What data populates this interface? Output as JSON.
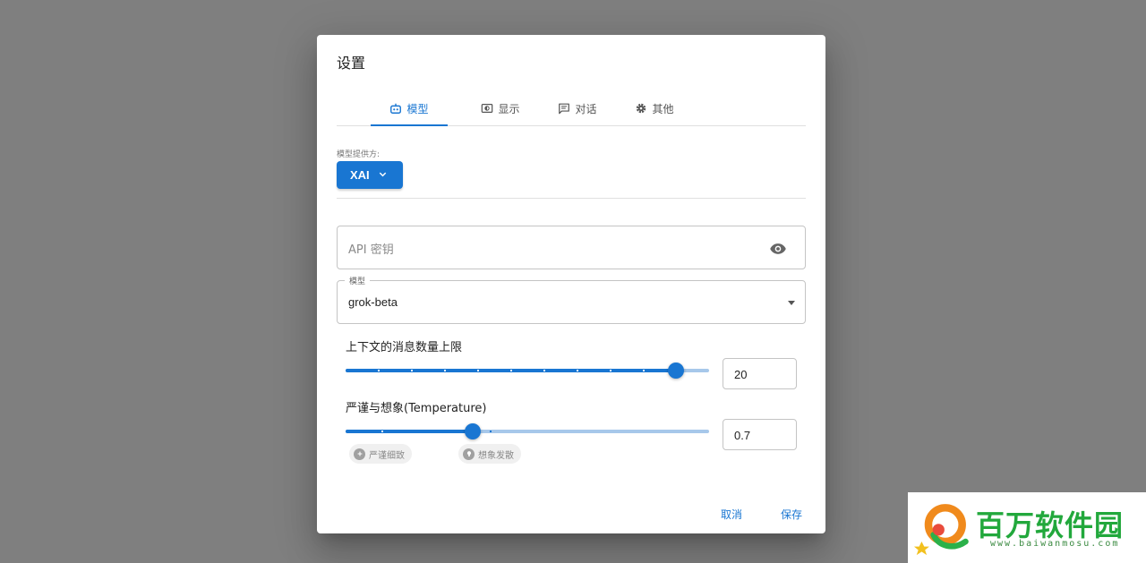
{
  "dialog": {
    "title": "设置"
  },
  "tabs": [
    {
      "label": "模型",
      "icon": "robot-icon",
      "active": true
    },
    {
      "label": "显示",
      "icon": "display-icon",
      "active": false
    },
    {
      "label": "对话",
      "icon": "chat-icon",
      "active": false
    },
    {
      "label": "其他",
      "icon": "gear-icon",
      "active": false
    }
  ],
  "provider": {
    "label": "模型提供方:",
    "value": "XAI"
  },
  "api_key": {
    "placeholder": "API 密钥",
    "value": ""
  },
  "model": {
    "legend": "模型",
    "value": "grok-beta"
  },
  "context_limit": {
    "label": "上下文的消息数量上限",
    "value": "20",
    "fraction": 0.91
  },
  "temperature": {
    "label": "严谨与想象(Temperature)",
    "value": "0.7",
    "fraction": 0.35,
    "chips": [
      "严谨细致",
      "想象发散"
    ]
  },
  "actions": {
    "cancel": "取消",
    "save": "保存"
  },
  "watermark": {
    "text": "百万软件园",
    "url": "www.baiwanmosu.com"
  },
  "colors": {
    "accent": "#1976d2",
    "overlay": "#7f7f7f",
    "watermark": "#22a83c"
  }
}
